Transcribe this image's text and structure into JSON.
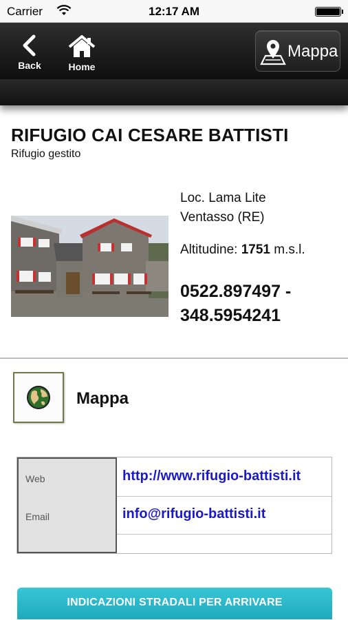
{
  "status_bar": {
    "carrier": "Carrier",
    "time": "12:17 AM",
    "wifi_icon": "wifi-icon",
    "battery_icon": "battery-icon"
  },
  "nav": {
    "back_label": "Back",
    "back_icon": "chevron-left-icon",
    "home_label": "Home",
    "home_icon": "home-icon",
    "map_label": "Mappa",
    "map_icon": "map-pin-icon"
  },
  "refuge": {
    "name": "RIFUGIO CAI CESARE BATTISTI",
    "type": "Rifugio gestito",
    "address_line1": "Loc. Lama Lite",
    "address_line2": "Ventasso (RE)",
    "altitude_label": "Altitudine: ",
    "altitude_value": "1751",
    "altitude_unit": " m.s.l.",
    "phone_line1": "0522.897497 -",
    "phone_line2": "348.5954241"
  },
  "map_section": {
    "icon": "globe-icon",
    "label": "Mappa"
  },
  "contacts": [
    {
      "label": "Web",
      "value": "http://www.rifugio-battisti.it"
    },
    {
      "label": "Email",
      "value": "info@rifugio-battisti.it"
    }
  ],
  "directions_button": "INDICAZIONI STRADALI PER ARRIVARE",
  "colors": {
    "nav_background": "#1b1b1b",
    "link": "#1a1acc",
    "button_accent": "#2bb8ca",
    "icon_border": "#6f7a4a"
  }
}
